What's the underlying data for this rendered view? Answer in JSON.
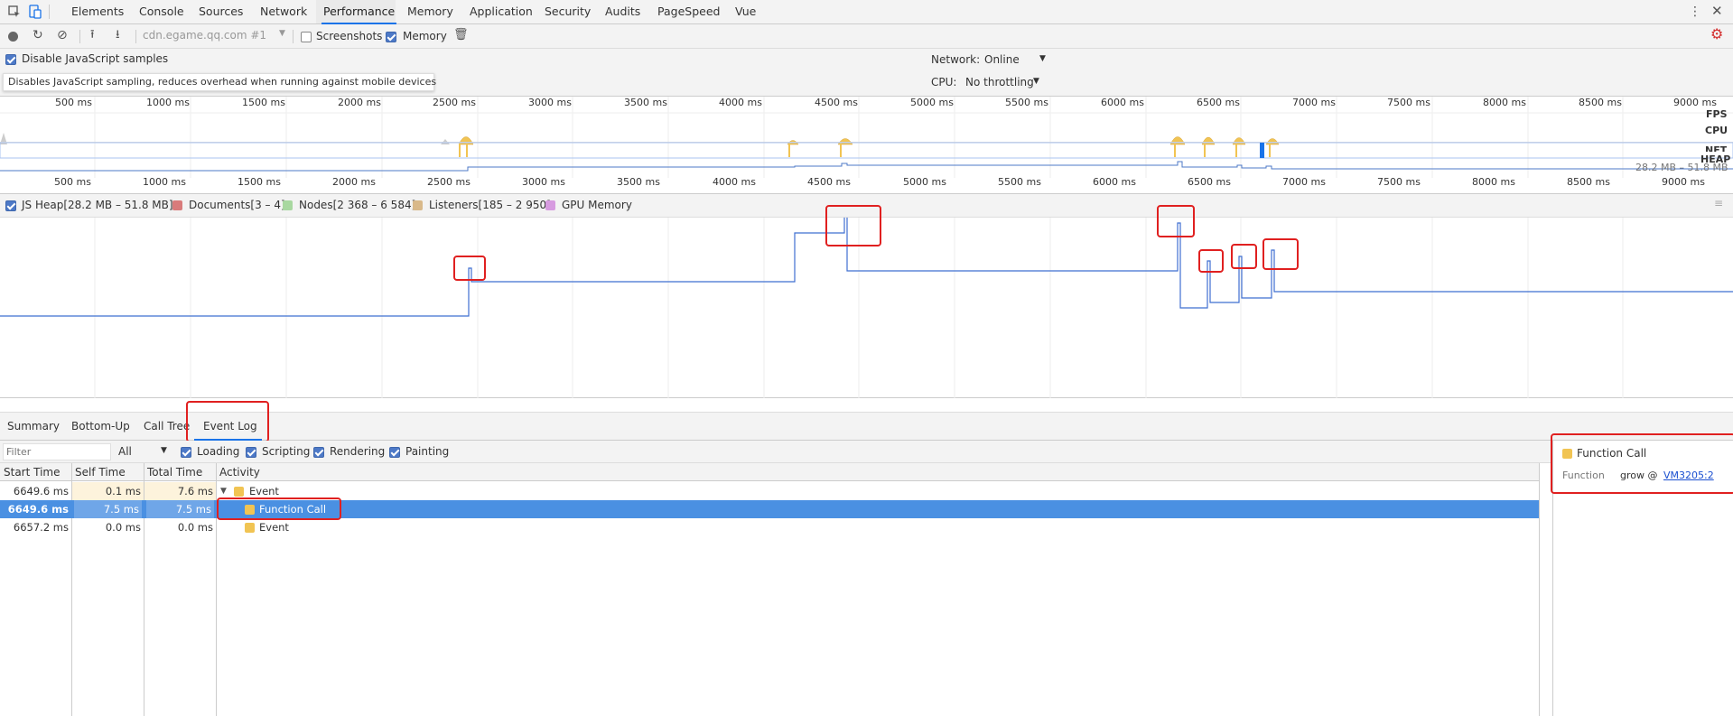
{
  "tabs": [
    "Elements",
    "Console",
    "Sources",
    "Network",
    "Performance",
    "Memory",
    "Application",
    "Security",
    "Audits",
    "PageSpeed",
    "Vue"
  ],
  "toolbar": {
    "target": "cdn.egame.qq.com #1",
    "screenshots_label": "Screenshots",
    "memory_label": "Memory"
  },
  "settings": {
    "disable_js_label": "Disable JavaScript samples",
    "tooltip": "Disables JavaScript sampling, reduces overhead when running against mobile devices",
    "network_label": "Network:",
    "network_value": "Online",
    "cpu_label": "CPU:",
    "cpu_value": "No throttling"
  },
  "overview": {
    "ticks": [
      "500 ms",
      "1000 ms",
      "1500 ms",
      "2000 ms",
      "2500 ms",
      "3000 ms",
      "3500 ms",
      "4000 ms",
      "4500 ms",
      "5000 ms",
      "5500 ms",
      "6000 ms",
      "6500 ms",
      "7000 ms",
      "7500 ms",
      "8000 ms",
      "8500 ms",
      "9000 ms"
    ],
    "tracks": [
      "FPS",
      "CPU",
      "NET",
      "HEAP"
    ],
    "heap_range": "28.2 MB – 51.8 MB"
  },
  "legend": {
    "items": [
      {
        "label": "JS Heap[28.2 MB – 51.8 MB]",
        "color": "#4d79c7",
        "checked": true
      },
      {
        "label": "Documents[3 – 4]",
        "color": "#d97b7b",
        "checked": false
      },
      {
        "label": "Nodes[2 368 – 6 584]",
        "color": "#a8d8a0",
        "checked": false
      },
      {
        "label": "Listeners[185 – 2 950]",
        "color": "#d9b98a",
        "checked": false
      },
      {
        "label": "GPU Memory",
        "color": "#d79be0",
        "checked": false
      }
    ]
  },
  "bottom_tabs": [
    "Summary",
    "Bottom-Up",
    "Call Tree",
    "Event Log"
  ],
  "filter": {
    "placeholder": "Filter",
    "category": "All",
    "checks": [
      "Loading",
      "Scripting",
      "Rendering",
      "Painting"
    ]
  },
  "table": {
    "headers": [
      "Start Time",
      "Self Time",
      "Total Time",
      "Activity"
    ],
    "rows": [
      {
        "start": "6649.6 ms",
        "self": "0.1 ms",
        "total": "7.6 ms",
        "activity": "Event",
        "selected": false
      },
      {
        "start": "6649.6 ms",
        "self": "7.5 ms",
        "total": "7.5 ms",
        "activity": "Function Call",
        "selected": true
      },
      {
        "start": "6657.2 ms",
        "self": "0.0 ms",
        "total": "0.0 ms",
        "activity": "Event",
        "selected": false
      }
    ]
  },
  "detail": {
    "title": "Function Call",
    "key": "Function",
    "func": "grow @ ",
    "link": "VM3205:2"
  },
  "colors": {
    "accent": "#1a73e8",
    "selection": "#4a90e2",
    "heap_line": "#3f6fd1",
    "scripting": "#f1c453",
    "annotation": "#e02020"
  }
}
